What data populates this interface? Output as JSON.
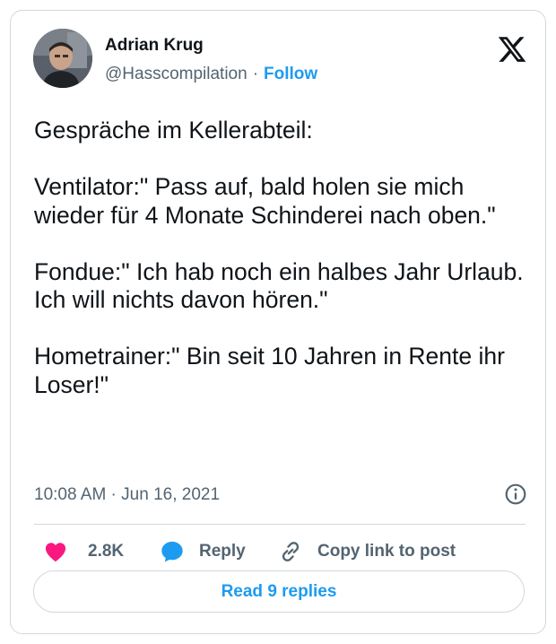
{
  "author": {
    "name": "Adrian Krug",
    "handle": "@Hasscompilation",
    "separator": "·",
    "follow_label": "Follow"
  },
  "tweet": {
    "paragraphs": [
      "Gespräche im Kellerabteil:",
      "Ventilator:\" Pass auf, bald holen sie mich wieder für 4 Monate Schinderei nach oben.\"",
      "Fondue:\" Ich hab noch ein halbes Jahr Urlaub. Ich will nichts davon hören.\"",
      "Hometrainer:\" Bin seit 10 Jahren in Rente ihr Loser!\""
    ],
    "timestamp": "10:08 AM · Jun 16, 2021"
  },
  "actions": {
    "like_count": "2.8K",
    "reply_label": "Reply",
    "copy_link_label": "Copy link to post"
  },
  "read_replies_label": "Read 9 replies",
  "icons": {
    "brand": "x-logo-icon",
    "info": "info-icon",
    "like": "heart-icon",
    "reply": "speech-bubble-icon",
    "copy": "link-icon"
  },
  "colors": {
    "accent": "#1d9bf0",
    "like": "#f91880",
    "text": "#0f1419",
    "muted": "#536471",
    "border": "#cfd9de"
  }
}
